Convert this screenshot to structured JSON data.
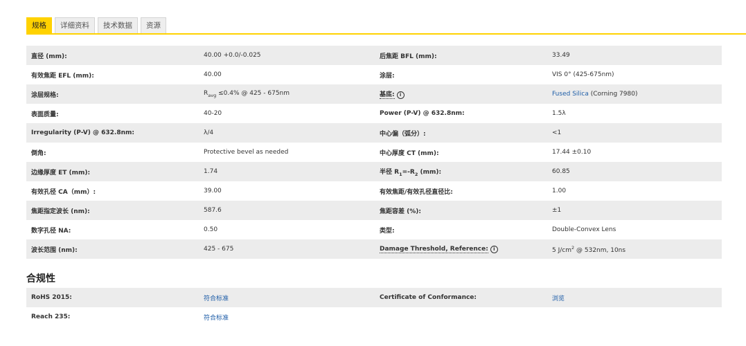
{
  "tabs": [
    "规格",
    "详细资料",
    "技术数据",
    "资源"
  ],
  "specs": {
    "r0": {
      "l1": "直径 (mm):",
      "v1": "40.00 +0.0/-0.025",
      "l2": "后焦距 BFL (mm):",
      "v2": "33.49"
    },
    "r1": {
      "l1": "有效焦距 EFL (mm):",
      "v1": "40.00",
      "l2": "涂层:",
      "v2": "VIS 0° (425-675nm)"
    },
    "r2": {
      "l1": "涂层规格:",
      "v1_pre": "R",
      "v1_sub": "avg",
      "v1_post": " ≤0.4% @ 425 - 675nm",
      "l2": "基底:",
      "v2_link": "Fused Silica",
      "v2_rest": " (Corning 7980)"
    },
    "r3": {
      "l1": "表面质量:",
      "v1": "40-20",
      "l2": "Power (P-V) @ 632.8nm:",
      "v2": "1.5λ"
    },
    "r4": {
      "l1": "Irregularity (P-V) @ 632.8nm:",
      "v1": "λ/4",
      "l2": "中心偏（弧分）:",
      "v2": "<1"
    },
    "r5": {
      "l1": "倒角:",
      "v1": "Protective bevel as needed",
      "l2": "中心厚度 CT (mm):",
      "v2": "17.44 ±0.10"
    },
    "r6": {
      "l1": "边缘厚度 ET (mm):",
      "v1": "1.74",
      "l2_pre": "半径 R",
      "l2_sub1": "1",
      "l2_mid": "=-R",
      "l2_sub2": "2",
      "l2_post": " (mm):",
      "v2": "60.85"
    },
    "r7": {
      "l1": "有效孔径 CA（mm）:",
      "v1": "39.00",
      "l2": "有效焦距/有效孔径直径比:",
      "v2": "1.00"
    },
    "r8": {
      "l1": "焦距指定波长 (nm):",
      "v1": "587.6",
      "l2": "焦距容差 (%):",
      "v2": "±1"
    },
    "r9": {
      "l1": "数字孔径 NA:",
      "v1": "0.50",
      "l2": "类型:",
      "v2": "Double-Convex Lens"
    },
    "r10": {
      "l1": "波长范围 (nm):",
      "v1": "425 - 675",
      "l2": "Damage Threshold, Reference:",
      "v2_pre": "5 J/cm",
      "v2_sup": "2",
      "v2_post": " @ 532nm, 10ns"
    }
  },
  "compliance": {
    "title": "合规性",
    "r0": {
      "l1": "RoHS 2015:",
      "v1": "符合标准",
      "l2": "Certificate of Conformance:",
      "v2": "浏览"
    },
    "r1": {
      "l1": "Reach 235:",
      "v1": "符合标准"
    }
  },
  "icons": {
    "info": "i"
  },
  "colors": {
    "accent": "#ffd200",
    "link": "#1f5ea8",
    "row_alt": "#ececec"
  }
}
